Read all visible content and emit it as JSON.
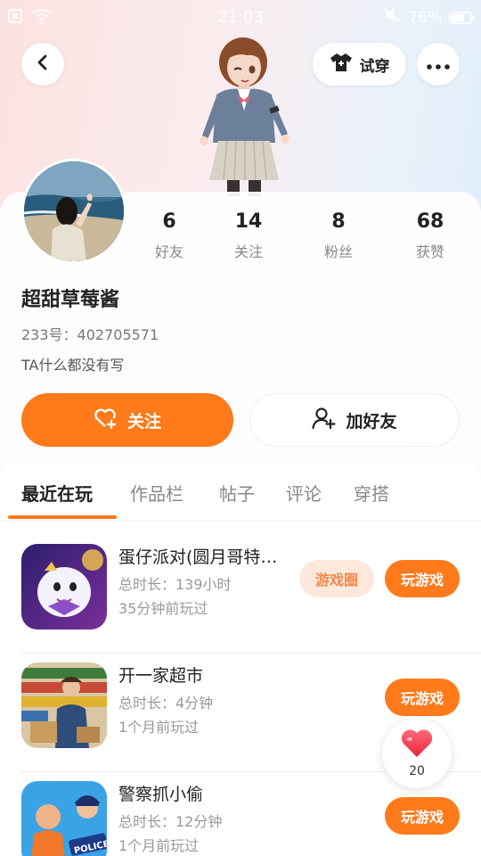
{
  "status_bar": {
    "time": "21:03",
    "battery": "76%"
  },
  "header": {
    "tryon_label": "试穿"
  },
  "profile": {
    "username": "超甜草莓酱",
    "user_id": "233号：402705571",
    "bio": "TA什么都没有写",
    "stats": [
      {
        "value": "6",
        "label": "好友"
      },
      {
        "value": "14",
        "label": "关注"
      },
      {
        "value": "8",
        "label": "粉丝"
      },
      {
        "value": "68",
        "label": "获赞"
      }
    ],
    "follow_label": "关注",
    "add_friend_label": "加好友"
  },
  "tabs": [
    {
      "label": "最近在玩",
      "active": true
    },
    {
      "label": "作品栏",
      "active": false
    },
    {
      "label": "帖子",
      "active": false
    },
    {
      "label": "评论",
      "active": false
    },
    {
      "label": "穿搭",
      "active": false
    }
  ],
  "games": [
    {
      "title": "蛋仔派对(圆月哥特…",
      "duration": "总时长：139小时",
      "last_played": "35分钟前玩过",
      "circle_label": "游戏圈",
      "play_label": "玩游戏"
    },
    {
      "title": "开一家超市",
      "duration": "总时长：4分钟",
      "last_played": "1个月前玩过",
      "play_label": "玩游戏"
    },
    {
      "title": "警察抓小偷",
      "duration": "总时长：12分钟",
      "last_played": "1个月前玩过",
      "play_label": "玩游戏"
    }
  ],
  "like_button": {
    "count": "20"
  },
  "colors": {
    "accent": "#ff7a1a",
    "tag_bg": "#fde8dc"
  }
}
